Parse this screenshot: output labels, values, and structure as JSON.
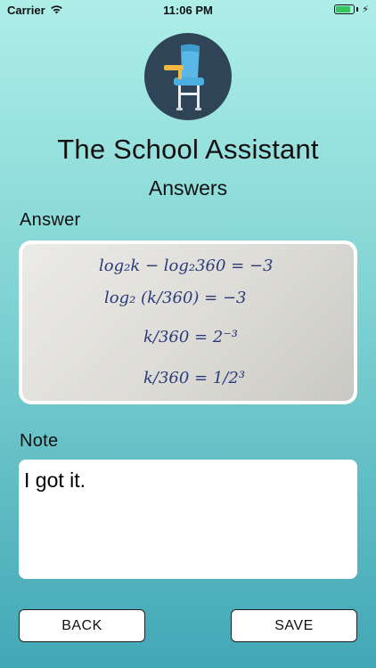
{
  "status_bar": {
    "carrier": "Carrier",
    "time": "11:06 PM",
    "battery_level": 0.85,
    "icons": [
      "wifi-icon",
      "battery-icon",
      "charging-bolt-icon"
    ]
  },
  "app": {
    "logo_icon": "school-chair-icon",
    "title": "The School Assistant",
    "subtitle": "Answers"
  },
  "answer": {
    "label": "Answer",
    "image_lines": [
      "log₂k − log₂360 = −3",
      "log₂ (k/360) = −3",
      "k/360 = 2⁻³",
      "k/360 = 1/2³"
    ]
  },
  "note": {
    "label": "Note",
    "value": "I got it."
  },
  "buttons": {
    "back": "BACK",
    "save": "SAVE"
  },
  "colors": {
    "background_top": "#aeeee8",
    "background_bottom": "#42a7b6",
    "logo_circle": "#2f4557",
    "chair_blue": "#5ab8e6"
  }
}
